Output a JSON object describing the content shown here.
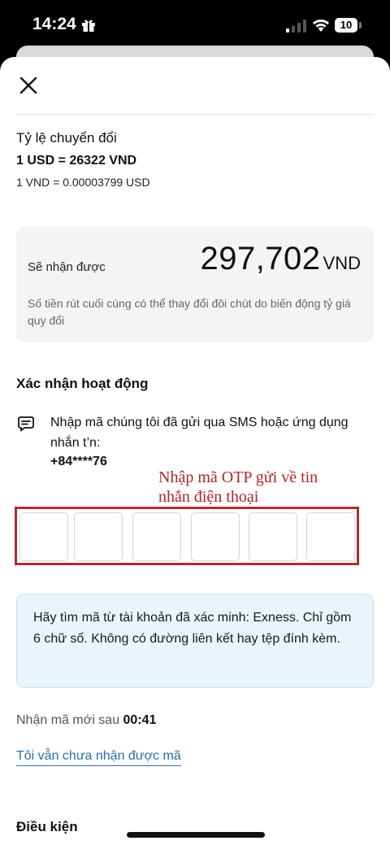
{
  "status_bar": {
    "time": "14:24",
    "battery": "10",
    "icons": [
      "gift-icon",
      "signal-icon",
      "wifi-icon",
      "battery-icon"
    ]
  },
  "header": {
    "close_icon": "close-icon"
  },
  "rate": {
    "title": "Tỷ lệ chuyển đổi",
    "main": "1 USD = 26322 VND",
    "sub": "1 VND = 0.00003799 USD"
  },
  "receive": {
    "label": "Sẽ nhận được",
    "value": "297,702",
    "currency": "VND",
    "note": "Số tiền rút cuối cùng có thể thay đổi đôi chút do biến động tỷ giá quy đổi"
  },
  "verification": {
    "title": "Xác nhận hoạt động",
    "icon": "message-icon",
    "instruction": "Nhập mã chúng tôi đã gửi qua SMS hoặc ứng dụng nhắn t’n:",
    "phone": "+84****76",
    "annotation": "Nhập mã OTP gửi về tin nhắn điện thoại",
    "otp_digits": 6,
    "otp_values": [
      "",
      "",
      "",
      "",
      "",
      ""
    ]
  },
  "info": {
    "text": "Hãy tìm mã từ tài khoản đã xác minh: Exness. Chỉ gồm 6 chữ số. Không có đường liên kết hay tệp đính kèm."
  },
  "resend": {
    "label": "Nhận mã mới sau",
    "time": "00:41"
  },
  "not_received_link": "Tôi vẫn chưa nhận được mã",
  "conditions_title": "Điều kiện",
  "colors": {
    "annotation": "#b0252b",
    "otp_frame": "#b22a32",
    "link": "#2a6fa8",
    "info_bg": "#eaf4fb",
    "card_bg": "#f4f4f5"
  }
}
